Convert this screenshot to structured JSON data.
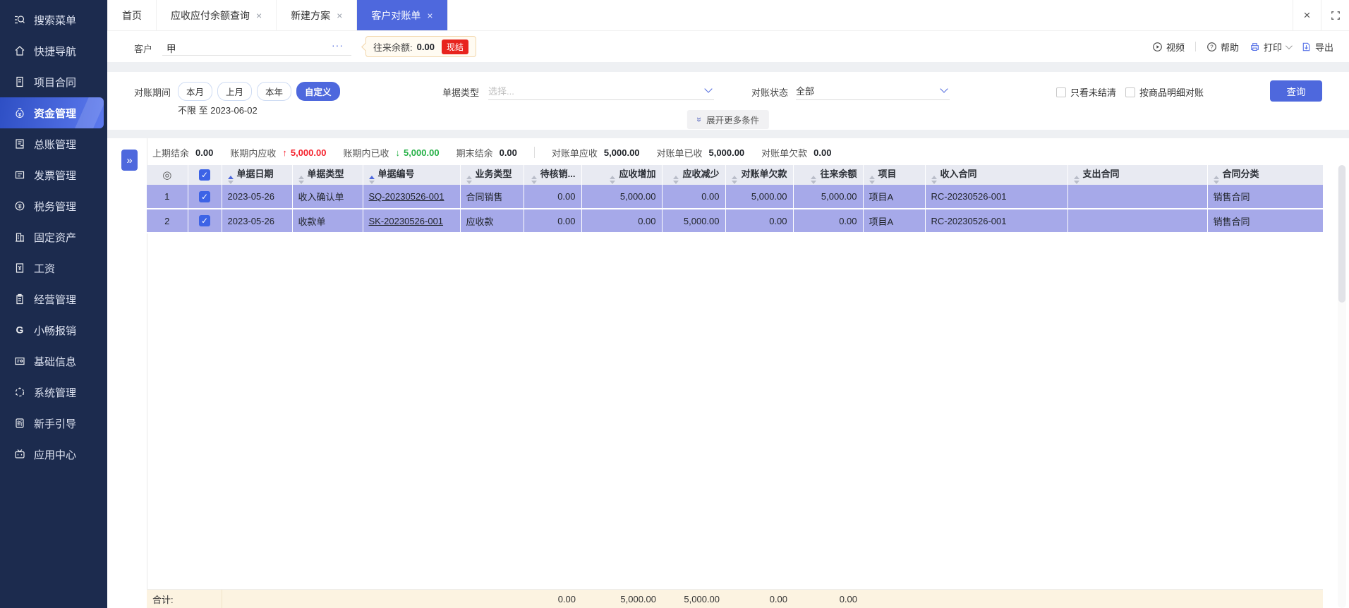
{
  "colors": {
    "accent": "#4e68dd",
    "sidebar_bg": "#1c2b4e",
    "selected_row": "#a6a9e9",
    "table_header": "#e8eaf2",
    "badge_red": "#e8231d",
    "increase_red": "#f5222d",
    "decrease_green": "#27b148",
    "footer_beige": "#fcf3e1"
  },
  "sidebar": {
    "items": [
      {
        "label": "搜索菜单",
        "icon": "search",
        "active": false
      },
      {
        "label": "快捷导航",
        "icon": "home",
        "active": false
      },
      {
        "label": "项目合同",
        "icon": "contract",
        "active": false
      },
      {
        "label": "资金管理",
        "icon": "money-bag",
        "active": true
      },
      {
        "label": "总账管理",
        "icon": "ledger",
        "active": false
      },
      {
        "label": "发票管理",
        "icon": "invoice",
        "active": false
      },
      {
        "label": "税务管理",
        "icon": "tax",
        "active": false
      },
      {
        "label": "固定资产",
        "icon": "asset",
        "active": false
      },
      {
        "label": "工资",
        "icon": "salary",
        "active": false
      },
      {
        "label": "经营管理",
        "icon": "clipboard",
        "active": false
      },
      {
        "label": "小畅报销",
        "icon": "g-logo",
        "active": false
      },
      {
        "label": "基础信息",
        "icon": "id-card",
        "active": false
      },
      {
        "label": "系统管理",
        "icon": "system",
        "active": false
      },
      {
        "label": "新手引导",
        "icon": "guide",
        "active": false
      },
      {
        "label": "应用中心",
        "icon": "app-center",
        "active": false
      }
    ]
  },
  "tabbar": {
    "tabs": [
      {
        "label": "首页",
        "closable": false,
        "active": false
      },
      {
        "label": "应收应付余额查询",
        "closable": true,
        "active": false
      },
      {
        "label": "新建方案",
        "closable": true,
        "active": false
      },
      {
        "label": "客户对账单",
        "closable": true,
        "active": true
      }
    ]
  },
  "toolbar": {
    "customer_label": "客户",
    "customer_value": "甲",
    "ellipsis": "···",
    "balance_label": "往来余额:",
    "balance_value": "0.00",
    "balance_badge": "现结",
    "actions": [
      {
        "label": "视频",
        "icon": "video",
        "dropdown": false
      },
      {
        "label": "帮助",
        "icon": "help",
        "dropdown": false
      },
      {
        "label": "打印",
        "icon": "printer",
        "dropdown": true
      },
      {
        "label": "导出",
        "icon": "export",
        "dropdown": false
      }
    ]
  },
  "filters": {
    "period_label": "对账期间",
    "period_options": [
      "本月",
      "上月",
      "本年",
      "自定义"
    ],
    "period_selected": "自定义",
    "period_range": "不限 至 2023-06-02",
    "doc_type_label": "单据类型",
    "doc_type_placeholder": "选择...",
    "status_label": "对账状态",
    "status_value": "全部",
    "checkbox_unsettled": "只看未结清",
    "checkbox_by_item": "按商品明细对账",
    "query_button": "查询",
    "expand_more": "展开更多条件"
  },
  "summary": {
    "items": [
      {
        "label": "上期结余",
        "value": "0.00",
        "trend": "",
        "divider_before": false
      },
      {
        "label": "账期内应收",
        "value": "5,000.00",
        "trend": "up",
        "divider_before": false
      },
      {
        "label": "账期内已收",
        "value": "5,000.00",
        "trend": "down",
        "divider_before": false
      },
      {
        "label": "期末结余",
        "value": "0.00",
        "trend": "",
        "divider_before": false
      },
      {
        "label": "对账单应收",
        "value": "5,000.00",
        "trend": "",
        "divider_before": true
      },
      {
        "label": "对账单已收",
        "value": "5,000.00",
        "trend": "",
        "divider_before": false
      },
      {
        "label": "对账单欠款",
        "value": "0.00",
        "trend": "",
        "divider_before": false
      }
    ]
  },
  "table": {
    "columns": [
      {
        "label": "",
        "type": "gear",
        "sort": "none"
      },
      {
        "label": "",
        "type": "checkbox",
        "sort": "none"
      },
      {
        "label": "单据日期",
        "type": "text",
        "sort": "asc"
      },
      {
        "label": "单据类型",
        "type": "text",
        "sort": "both"
      },
      {
        "label": "单据编号",
        "type": "text",
        "sort": "asc"
      },
      {
        "label": "业务类型",
        "type": "text",
        "sort": "both"
      },
      {
        "label": "待核销...",
        "type": "text",
        "sort": "both"
      },
      {
        "label": "应收增加",
        "type": "text",
        "sort": "both"
      },
      {
        "label": "应收减少",
        "type": "text",
        "sort": "both"
      },
      {
        "label": "对账单欠款",
        "type": "text",
        "sort": "both"
      },
      {
        "label": "往来余额",
        "type": "text",
        "sort": "both"
      },
      {
        "label": "项目",
        "type": "text",
        "sort": "both"
      },
      {
        "label": "收入合同",
        "type": "text",
        "sort": "both"
      },
      {
        "label": "支出合同",
        "type": "text",
        "sort": "both"
      },
      {
        "label": "合同分类",
        "type": "text",
        "sort": "both"
      }
    ],
    "rows": [
      {
        "num": "1",
        "checked": true,
        "cells": [
          "2023-05-26",
          "收入确认单",
          "SQ-20230526-001",
          "合同销售",
          "0.00",
          "5,000.00",
          "0.00",
          "5,000.00",
          "5,000.00",
          "项目A",
          "RC-20230526-001",
          "",
          "销售合同"
        ]
      },
      {
        "num": "2",
        "checked": true,
        "cells": [
          "2023-05-26",
          "收款单",
          "SK-20230526-001",
          "应收款",
          "0.00",
          "0.00",
          "5,000.00",
          "0.00",
          "0.00",
          "项目A",
          "RC-20230526-001",
          "",
          "销售合同"
        ]
      }
    ],
    "footer": {
      "label": "合计:",
      "cells": [
        "",
        "",
        "",
        "",
        "0.00",
        "5,000.00",
        "5,000.00",
        "0.00",
        "0.00",
        "",
        "",
        "",
        ""
      ]
    }
  }
}
